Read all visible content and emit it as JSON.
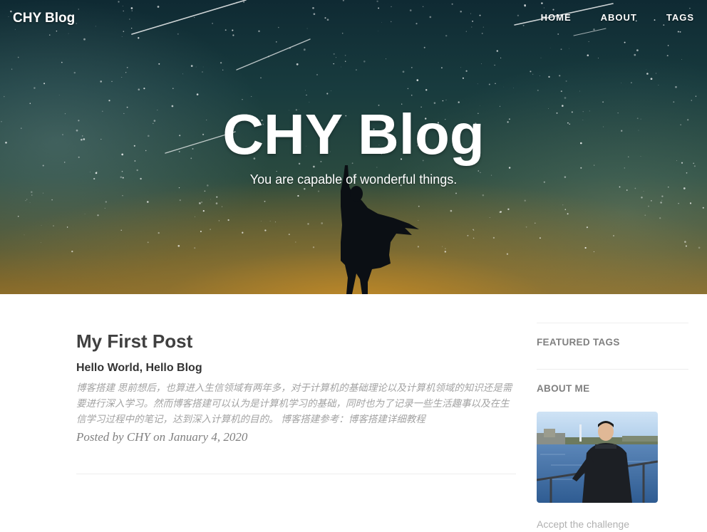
{
  "nav": {
    "brand": "CHY Blog",
    "links": [
      "HOME",
      "ABOUT",
      "TAGS"
    ]
  },
  "hero": {
    "title": "CHY Blog",
    "subtitle": "You are capable of wonderful things."
  },
  "post": {
    "title": "My First Post",
    "subtitle": "Hello World, Hello Blog",
    "excerpt": "博客搭建 思前想后，也算进入生信领域有两年多，对于计算机的基础理论以及计算机领域的知识还是需要进行深入学习。然而博客搭建可以认为是计算机学习的基础，同时也为了记录一些生活趣事以及在生信学习过程中的笔记，达到深入计算机的目的。 博客搭建参考：博客搭建详细教程",
    "meta": "Posted by CHY on January 4, 2020"
  },
  "sidebar": {
    "featured_tags_heading": "FEATURED TAGS",
    "about_me_heading": "ABOUT ME",
    "about_text": "Accept the challenge"
  },
  "colors": {
    "post_title": "#404040",
    "sidebar_heading": "#808080",
    "excerpt": "#a3a3a3"
  }
}
